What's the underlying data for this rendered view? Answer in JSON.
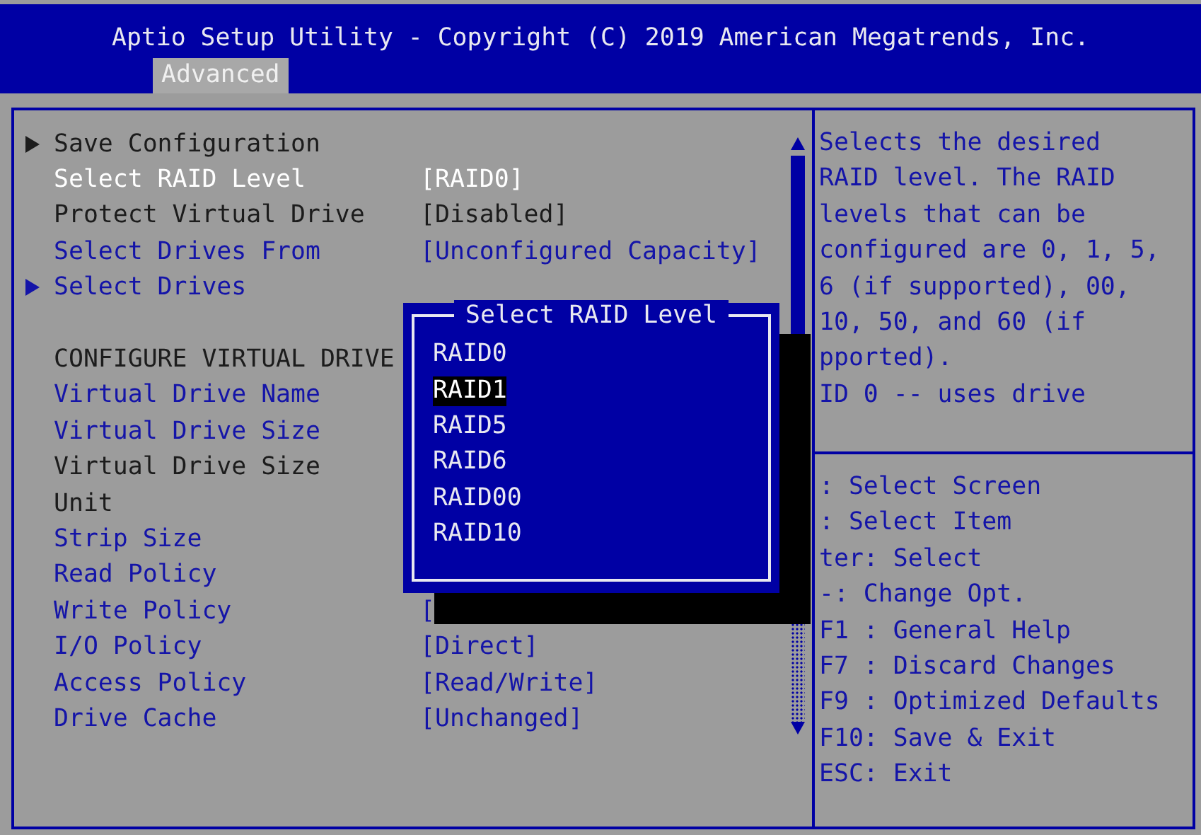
{
  "header": {
    "title": "Aptio Setup Utility - Copyright (C) 2019 American Megatrends, Inc.",
    "tabs": [
      {
        "label": "Advanced",
        "selected": true
      }
    ]
  },
  "settings": [
    {
      "kind": "submenu",
      "label": "Save Configuration",
      "disabled": true,
      "selected": false
    },
    {
      "kind": "setting",
      "label": "Select RAID Level",
      "value": "[RAID0]",
      "disabled": false,
      "selected": true
    },
    {
      "kind": "setting",
      "label": "Protect Virtual Drive",
      "value": "[Disabled]",
      "disabled": true,
      "selected": false
    },
    {
      "kind": "setting",
      "label": "Select Drives From",
      "value": "[Unconfigured Capacity]",
      "disabled": false,
      "selected": false
    },
    {
      "kind": "submenu",
      "label": "Select Drives",
      "disabled": false,
      "selected": false
    },
    {
      "kind": "blank"
    },
    {
      "kind": "heading",
      "label": "CONFIGURE VIRTUAL DRIVE"
    },
    {
      "kind": "setting",
      "label": "Virtual Drive Name",
      "disabled": false,
      "selected": false
    },
    {
      "kind": "setting",
      "label": "Virtual Drive Size",
      "disabled": false,
      "selected": false
    },
    {
      "kind": "setting",
      "label": "Virtual Drive Size",
      "disabled": true,
      "selected": false
    },
    {
      "kind": "setting",
      "label": "Unit",
      "disabled": true,
      "selected": false
    },
    {
      "kind": "setting",
      "label": "Strip Size",
      "disabled": false,
      "selected": false
    },
    {
      "kind": "setting",
      "label": "Read Policy",
      "disabled": false,
      "selected": false
    },
    {
      "kind": "setting",
      "label": "Write Policy",
      "value": "[",
      "disabled": false,
      "selected": false
    },
    {
      "kind": "setting",
      "label": "I/O Policy",
      "value": "[Direct]",
      "disabled": false,
      "selected": false
    },
    {
      "kind": "setting",
      "label": "Access Policy",
      "value": "[Read/Write]",
      "disabled": false,
      "selected": false
    },
    {
      "kind": "setting",
      "label": "Drive Cache",
      "value": "[Unchanged]",
      "disabled": false,
      "selected": false
    }
  ],
  "popup": {
    "title": "Select RAID Level",
    "options": [
      {
        "label": "RAID0",
        "selected": false
      },
      {
        "label": "RAID1",
        "selected": true
      },
      {
        "label": "RAID5",
        "selected": false
      },
      {
        "label": "RAID6",
        "selected": false
      },
      {
        "label": "RAID00",
        "selected": false
      },
      {
        "label": "RAID10",
        "selected": false
      }
    ]
  },
  "help_lines": [
    "Selects the desired",
    "RAID level. The RAID",
    "levels that can be",
    "configured are 0, 1, 5,",
    "6 (if supported), 00,",
    "10, 50, and 60 (if",
    "pported).",
    "ID 0 -- uses drive"
  ],
  "key_lines": [
    ": Select Screen",
    ": Select Item",
    "ter: Select",
    "-: Change Opt.",
    "F1 : General Help",
    "F7 : Discard Changes",
    "F9 : Optimized Defaults",
    "F10: Save & Exit",
    "ESC: Exit"
  ]
}
